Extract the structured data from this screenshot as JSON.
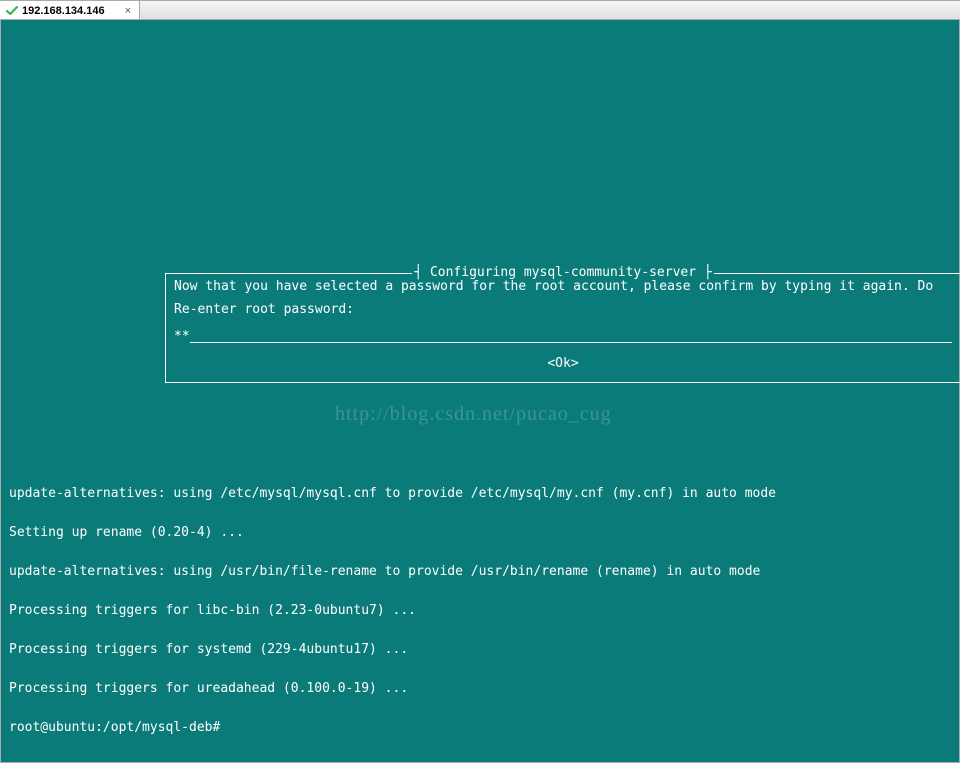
{
  "tab": {
    "title": "192.168.134.146",
    "close_glyph": "×"
  },
  "dialog": {
    "title": "Configuring mysql-community-server",
    "message": "Now that you have selected a password for the root account, please confirm by typing it again. Do ",
    "prompt": "Re-enter root password:",
    "password_masked": "**",
    "ok_label": "<Ok>"
  },
  "watermark": "http://blog.csdn.net/pucao_cug",
  "terminal_output": {
    "lines": [
      "update-alternatives: using /etc/mysql/mysql.cnf to provide /etc/mysql/my.cnf (my.cnf) in auto mode",
      "Setting up rename (0.20-4) ...",
      "update-alternatives: using /usr/bin/file-rename to provide /usr/bin/rename (rename) in auto mode",
      "Processing triggers for libc-bin (2.23-0ubuntu7) ...",
      "Processing triggers for systemd (229-4ubuntu17) ...",
      "Processing triggers for ureadahead (0.100.0-19) ...",
      "root@ubuntu:/opt/mysql-deb#"
    ]
  }
}
